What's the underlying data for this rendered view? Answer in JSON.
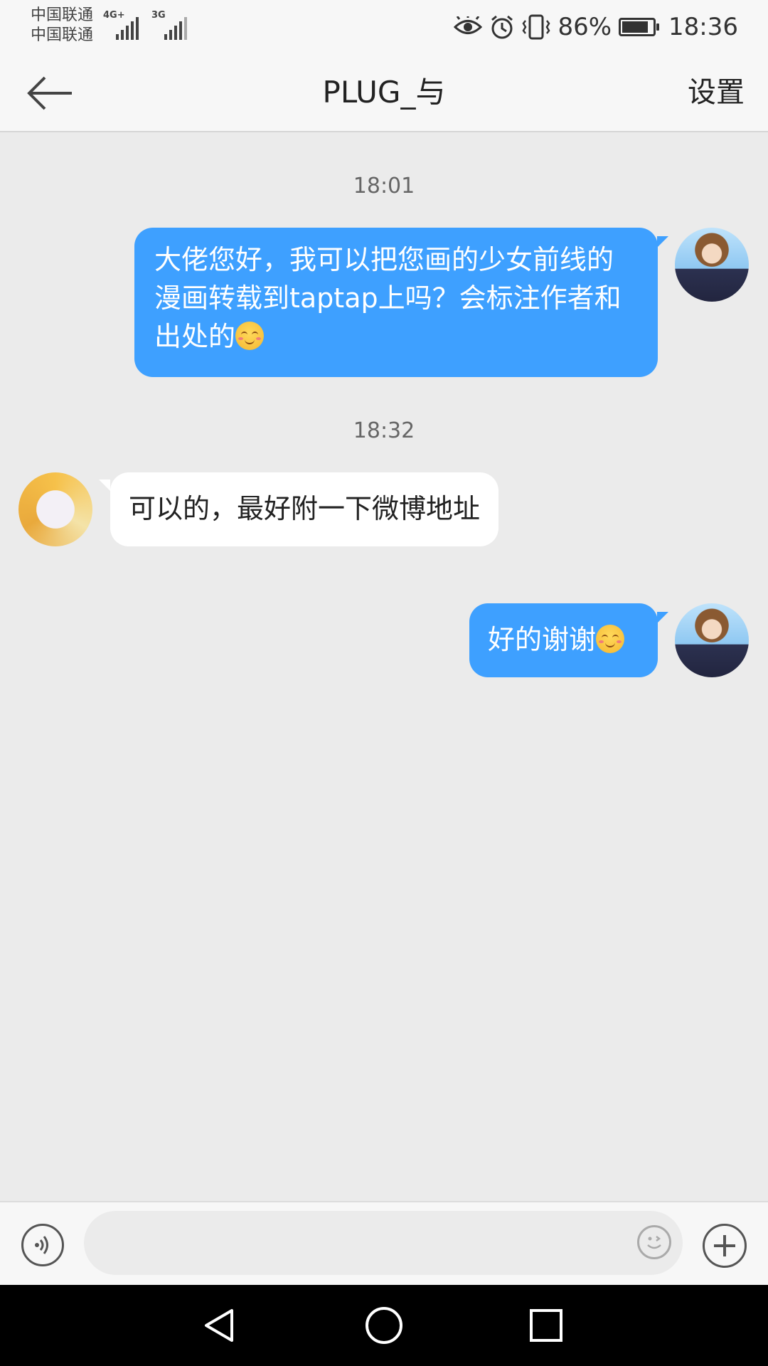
{
  "status_bar": {
    "carrier_1": "中国联通",
    "carrier_2": "中国联通",
    "network_1": "4G+",
    "network_2": "3G",
    "battery_percent": "86%",
    "battery_level": 0.86,
    "time": "18:36",
    "icons": [
      "eye-icon",
      "alarm-icon",
      "vibrate-icon",
      "battery-icon"
    ]
  },
  "header": {
    "back_icon": "back-arrow-icon",
    "title": "PLUG_与",
    "settings_label": "设置"
  },
  "messages": [
    {
      "type": "time",
      "text": "18:01"
    },
    {
      "type": "sent",
      "text": "大佬您好，我可以把您画的少女前线的漫画转载到taptap上吗？会标注作者和出处的",
      "emoji": "blush-smile-emoji"
    },
    {
      "type": "time",
      "text": "18:32"
    },
    {
      "type": "received",
      "text": "可以的，最好附一下微博地址"
    },
    {
      "type": "sent",
      "text": "好的谢谢",
      "emoji": "blush-smile-emoji"
    }
  ],
  "input_bar": {
    "voice_icon": "voice-icon",
    "placeholder": "",
    "emoji_icon": "emoji-icon",
    "plus_icon": "plus-icon"
  },
  "nav_bar": {
    "icons": [
      "back-triangle-icon",
      "home-circle-icon",
      "recents-square-icon"
    ]
  },
  "colors": {
    "accent": "#3ea0ff",
    "background": "#ebebeb",
    "bar": "#f7f7f7"
  }
}
